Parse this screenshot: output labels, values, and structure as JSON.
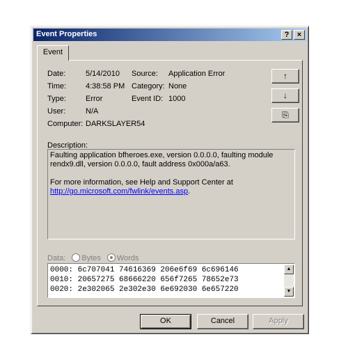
{
  "window": {
    "title": "Event Properties",
    "help_label": "?",
    "close_label": "×"
  },
  "tabs": [
    {
      "label": "Event"
    }
  ],
  "event": {
    "date_label": "Date:",
    "date": "5/14/2010",
    "time_label": "Time:",
    "time": "4:38:58 PM",
    "type_label": "Type:",
    "type": "Error",
    "user_label": "User:",
    "user": "N/A",
    "computer_label": "Computer:",
    "computer": "DARKSLAYER54",
    "source_label": "Source:",
    "source": "Application Error",
    "category_label": "Category:",
    "category": "None",
    "eventid_label": "Event ID:",
    "eventid": "1000"
  },
  "nav": {
    "up": "↑",
    "down": "↓",
    "copy": "⎘"
  },
  "description": {
    "label": "Description:",
    "line1": "Faulting application bfheroes.exe, version 0.0.0.0, faulting module",
    "line2": "rendx9.dll, version 0.0.0.0, fault address 0x000a/a63.",
    "line3": "For more information, see Help and Support Center at",
    "link": "http://go.microsoft.com/fwlink/events.asp",
    "link_suffix": "."
  },
  "data": {
    "label": "Data:",
    "options": [
      {
        "label": "Bytes",
        "selected": false
      },
      {
        "label": "Words",
        "selected": true
      }
    ],
    "lines": [
      "0000: 6c707041 74616369 206e6f69 6c696146",
      "0010: 20657275 68666220 656f7265 78652e73",
      "0020: 2e302065 2e302e30 6e692030 6e657220"
    ]
  },
  "buttons": {
    "ok": "OK",
    "cancel": "Cancel",
    "apply": "Apply"
  }
}
